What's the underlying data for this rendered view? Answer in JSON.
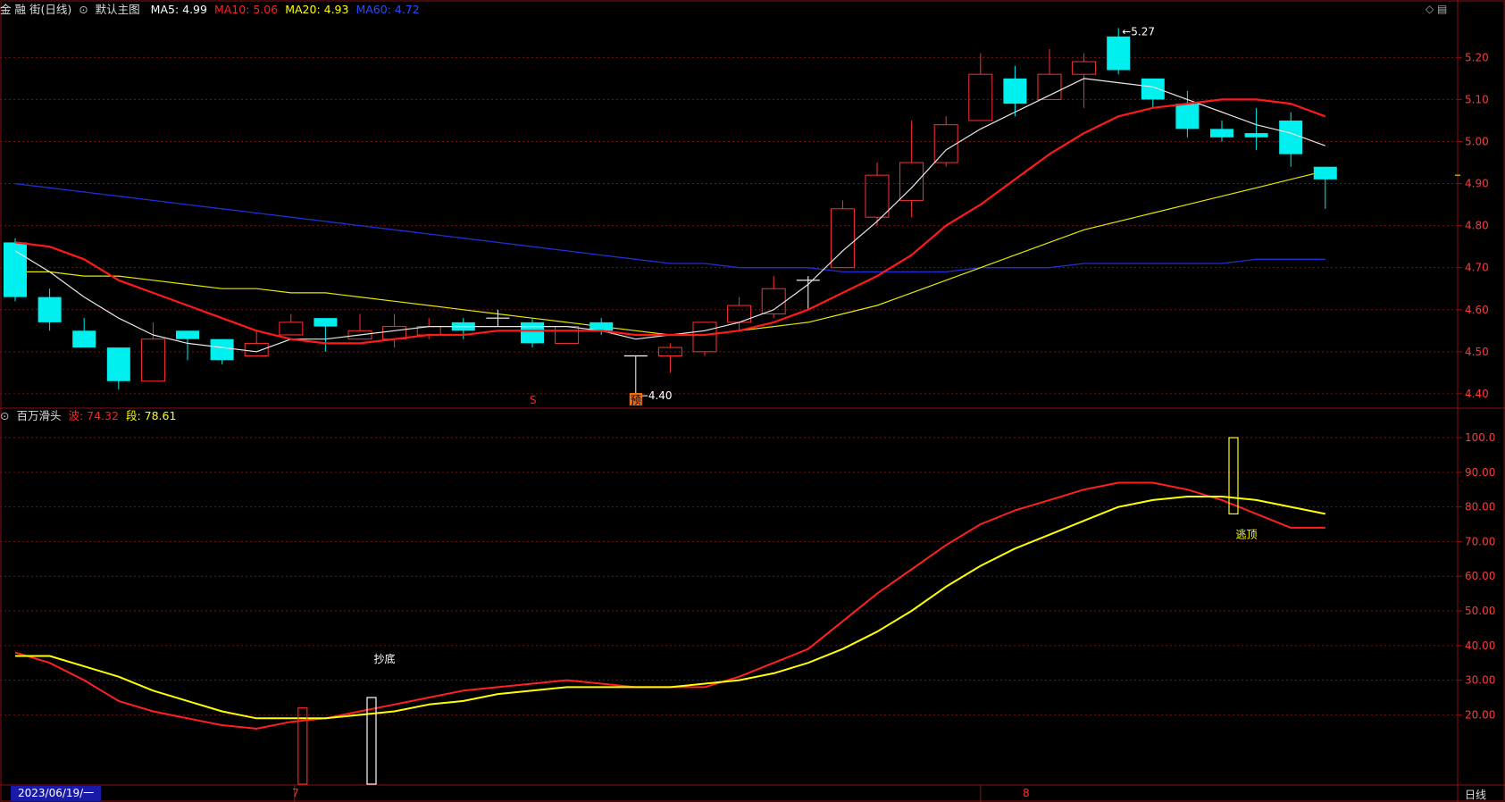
{
  "header": {
    "symbol": "金 融 街(日线)",
    "main_label": "默认主图",
    "ma": [
      {
        "label": "MA5: 4.99",
        "color": "#ffffff"
      },
      {
        "label": "MA10: 5.06",
        "color": "#ff2020"
      },
      {
        "label": "MA20: 4.93",
        "color": "#ffff00"
      },
      {
        "label": "MA60: 4.72",
        "color": "#2040ff"
      }
    ],
    "corner_icons": "◇ ▤"
  },
  "sub_header": {
    "indicator": "百万滑头",
    "wave_label": "波: 74.32",
    "seg_label": "段: 78.61"
  },
  "footer": {
    "date": "2023/06/19/一",
    "month1": "7",
    "month2": "8",
    "period": "日线"
  },
  "chart_data": [
    {
      "type": "candlestick",
      "y_ticks": [
        "5.20",
        "5.10",
        "5.00",
        "4.90",
        "4.80",
        "4.70",
        "4.60",
        "4.50",
        "4.40"
      ],
      "ylim": [
        4.37,
        5.29
      ],
      "candles": [
        {
          "o": 4.76,
          "h": 4.77,
          "l": 4.62,
          "c": 4.63
        },
        {
          "o": 4.63,
          "h": 4.65,
          "l": 4.55,
          "c": 4.57
        },
        {
          "o": 4.55,
          "h": 4.58,
          "l": 4.51,
          "c": 4.51
        },
        {
          "o": 4.51,
          "h": 4.51,
          "l": 4.41,
          "c": 4.43
        },
        {
          "o": 4.43,
          "h": 4.57,
          "l": 4.43,
          "c": 4.53
        },
        {
          "o": 4.55,
          "h": 4.55,
          "l": 4.48,
          "c": 4.53
        },
        {
          "o": 4.53,
          "h": 4.53,
          "l": 4.47,
          "c": 4.48
        },
        {
          "o": 4.49,
          "h": 4.55,
          "l": 4.49,
          "c": 4.52
        },
        {
          "o": 4.54,
          "h": 4.59,
          "l": 4.54,
          "c": 4.57
        },
        {
          "o": 4.58,
          "h": 4.58,
          "l": 4.5,
          "c": 4.56
        },
        {
          "o": 4.53,
          "h": 4.59,
          "l": 4.53,
          "c": 4.55
        },
        {
          "o": 4.53,
          "h": 4.59,
          "l": 4.51,
          "c": 4.56
        },
        {
          "o": 4.54,
          "h": 4.58,
          "l": 4.53,
          "c": 4.56
        },
        {
          "o": 4.57,
          "h": 4.58,
          "l": 4.53,
          "c": 4.55
        },
        {
          "o": 4.58,
          "h": 4.6,
          "l": 4.56,
          "c": 4.58
        },
        {
          "o": 4.57,
          "h": 4.58,
          "l": 4.51,
          "c": 4.52
        },
        {
          "o": 4.52,
          "h": 4.56,
          "l": 4.52,
          "c": 4.56
        },
        {
          "o": 4.57,
          "h": 4.58,
          "l": 4.54,
          "c": 4.55
        },
        {
          "o": 4.49,
          "h": 4.49,
          "l": 4.4,
          "c": 4.49
        },
        {
          "o": 4.49,
          "h": 4.52,
          "l": 4.45,
          "c": 4.51
        },
        {
          "o": 4.5,
          "h": 4.57,
          "l": 4.49,
          "c": 4.57
        },
        {
          "o": 4.57,
          "h": 4.63,
          "l": 4.55,
          "c": 4.61
        },
        {
          "o": 4.59,
          "h": 4.68,
          "l": 4.58,
          "c": 4.65
        },
        {
          "o": 4.67,
          "h": 4.68,
          "l": 4.6,
          "c": 4.67
        },
        {
          "o": 4.7,
          "h": 4.86,
          "l": 4.7,
          "c": 4.84
        },
        {
          "o": 4.82,
          "h": 4.95,
          "l": 4.8,
          "c": 4.92
        },
        {
          "o": 4.86,
          "h": 5.05,
          "l": 4.82,
          "c": 4.95
        },
        {
          "o": 4.95,
          "h": 5.06,
          "l": 4.94,
          "c": 5.04
        },
        {
          "o": 5.05,
          "h": 5.21,
          "l": 5.05,
          "c": 5.16
        },
        {
          "o": 5.15,
          "h": 5.18,
          "l": 5.06,
          "c": 5.09
        },
        {
          "o": 5.1,
          "h": 5.22,
          "l": 5.1,
          "c": 5.16
        },
        {
          "o": 5.16,
          "h": 5.21,
          "l": 5.08,
          "c": 5.19
        },
        {
          "o": 5.25,
          "h": 5.27,
          "l": 5.16,
          "c": 5.17
        },
        {
          "o": 5.15,
          "h": 5.15,
          "l": 5.08,
          "c": 5.1
        },
        {
          "o": 5.09,
          "h": 5.12,
          "l": 5.01,
          "c": 5.03
        },
        {
          "o": 5.03,
          "h": 5.05,
          "l": 5.0,
          "c": 5.01
        },
        {
          "o": 5.02,
          "h": 5.08,
          "l": 4.98,
          "c": 5.01
        },
        {
          "o": 5.05,
          "h": 5.07,
          "l": 4.94,
          "c": 4.97
        },
        {
          "o": 4.94,
          "h": 4.94,
          "l": 4.84,
          "c": 4.91
        }
      ],
      "ma5": [
        4.74,
        4.69,
        4.63,
        4.58,
        4.54,
        4.52,
        4.51,
        4.5,
        4.53,
        4.53,
        4.54,
        4.55,
        4.56,
        4.56,
        4.56,
        4.56,
        4.56,
        4.55,
        4.53,
        4.54,
        4.55,
        4.57,
        4.6,
        4.66,
        4.74,
        4.81,
        4.89,
        4.98,
        5.03,
        5.07,
        5.11,
        5.15,
        5.14,
        5.13,
        5.1,
        5.07,
        5.04,
        5.02,
        4.99
      ],
      "ma10": [
        4.76,
        4.75,
        4.72,
        4.67,
        4.64,
        4.61,
        4.58,
        4.55,
        4.53,
        4.52,
        4.52,
        4.53,
        4.54,
        4.54,
        4.55,
        4.55,
        4.55,
        4.55,
        4.54,
        4.54,
        4.54,
        4.55,
        4.57,
        4.6,
        4.64,
        4.68,
        4.73,
        4.8,
        4.85,
        4.91,
        4.97,
        5.02,
        5.06,
        5.08,
        5.09,
        5.1,
        5.1,
        5.09,
        5.06
      ],
      "ma20": [
        4.69,
        4.69,
        4.68,
        4.68,
        4.67,
        4.66,
        4.65,
        4.65,
        4.64,
        4.64,
        4.63,
        4.62,
        4.61,
        4.6,
        4.59,
        4.58,
        4.57,
        4.56,
        4.55,
        4.54,
        4.54,
        4.55,
        4.56,
        4.57,
        4.59,
        4.61,
        4.64,
        4.67,
        4.7,
        4.73,
        4.76,
        4.79,
        4.81,
        4.83,
        4.85,
        4.87,
        4.89,
        4.91,
        4.93
      ],
      "ma60": [
        4.9,
        4.89,
        4.88,
        4.87,
        4.86,
        4.85,
        4.84,
        4.83,
        4.82,
        4.81,
        4.8,
        4.79,
        4.78,
        4.77,
        4.76,
        4.75,
        4.74,
        4.73,
        4.72,
        4.71,
        4.71,
        4.7,
        4.7,
        4.7,
        4.69,
        4.69,
        4.69,
        4.69,
        4.7,
        4.7,
        4.7,
        4.71,
        4.71,
        4.71,
        4.71,
        4.71,
        4.72,
        4.72,
        4.72
      ],
      "annotations": [
        {
          "index": 32,
          "value": 5.27,
          "label": "5.27"
        },
        {
          "index": 18,
          "value": 4.4,
          "label": "4.40"
        }
      ],
      "signals": [
        {
          "index": 15,
          "label": "S",
          "color": "#ff2020"
        },
        {
          "index": 18,
          "label": "预",
          "color": "#ff6a00"
        }
      ]
    },
    {
      "type": "line",
      "y_ticks": [
        "100.0",
        "90.00",
        "80.00",
        "70.00",
        "60.00",
        "50.00",
        "40.00",
        "30.00",
        "20.00"
      ],
      "ylim": [
        0,
        108
      ],
      "series": [
        {
          "name": "波",
          "color": "#ff2020",
          "values": [
            38,
            35,
            30,
            24,
            21,
            19,
            17,
            16,
            18,
            19,
            21,
            23,
            25,
            27,
            28,
            29,
            30,
            29,
            28,
            28,
            28,
            31,
            35,
            39,
            47,
            55,
            62,
            69,
            75,
            79,
            82,
            85,
            87,
            87,
            85,
            82,
            78,
            74,
            74
          ]
        },
        {
          "name": "段",
          "color": "#ffff00",
          "values": [
            37,
            37,
            34,
            31,
            27,
            24,
            21,
            19,
            19,
            19,
            20,
            21,
            23,
            24,
            26,
            27,
            28,
            28,
            28,
            28,
            29,
            30,
            32,
            35,
            39,
            44,
            50,
            57,
            63,
            68,
            72,
            76,
            80,
            82,
            83,
            83,
            82,
            80,
            78
          ]
        }
      ],
      "markers": [
        {
          "index": 8,
          "bottom": 0,
          "top": 22,
          "color": "#ff2020"
        },
        {
          "index": 10,
          "bottom": 0,
          "top": 25,
          "color": "#ffffff"
        },
        {
          "index": 35,
          "bottom": 78,
          "top": 100,
          "color": "#ffff00"
        }
      ],
      "labels": [
        {
          "index": 10.4,
          "value": 35,
          "text": "抄底",
          "color": "#ffffff"
        },
        {
          "index": 35.4,
          "value": 71,
          "text": "逃顶",
          "color": "#ffff00"
        }
      ]
    }
  ]
}
